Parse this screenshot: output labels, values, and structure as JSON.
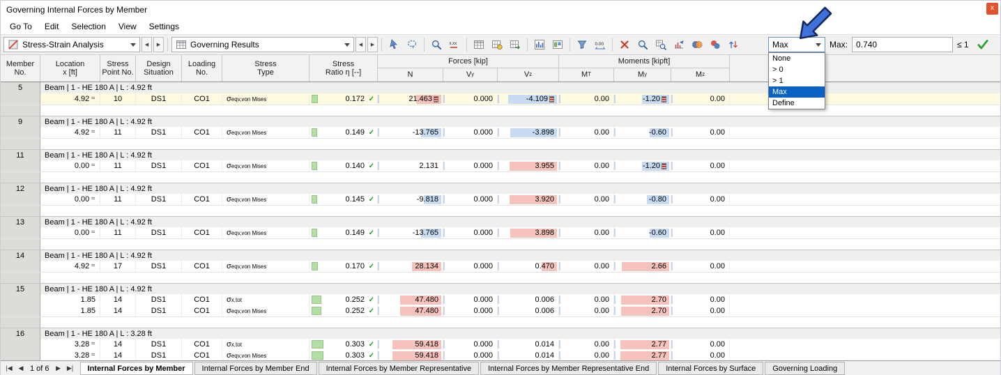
{
  "window": {
    "title": "Governing Internal Forces by Member",
    "close_label": "x"
  },
  "menu": {
    "items": [
      "Go To",
      "Edit",
      "Selection",
      "View",
      "Settings"
    ]
  },
  "toolbar": {
    "analysis_label": "Stress-Strain Analysis",
    "results_label": "Governing Results",
    "nav": {
      "prev": "◀",
      "next": "▶"
    },
    "icon_groups": [
      [
        {
          "name": "pointer-select-icon",
          "type": "pointer"
        },
        {
          "name": "lasso-select-icon",
          "type": "lasso"
        }
      ],
      [
        {
          "name": "show-result-values-icon",
          "type": "maglens"
        },
        {
          "name": "numeric-values-icon",
          "type": "xxx"
        }
      ],
      [
        {
          "name": "table-view-icon",
          "type": "table"
        },
        {
          "name": "table-manager-icon",
          "type": "table2"
        },
        {
          "name": "table-export-icon",
          "type": "table3"
        }
      ],
      [
        {
          "name": "result-diagram-icon",
          "type": "chart"
        },
        {
          "name": "result-panel-icon",
          "type": "panel"
        }
      ],
      [
        {
          "name": "filter-icon",
          "type": "funnel"
        },
        {
          "name": "decimal-places-icon",
          "type": "zeros"
        }
      ],
      [
        {
          "name": "delete-results-icon",
          "type": "delete"
        },
        {
          "name": "search-icon",
          "type": "maglens"
        },
        {
          "name": "find-in-table-icon",
          "type": "magtable"
        },
        {
          "name": "result-relations-icon",
          "type": "chartarrow"
        },
        {
          "name": "color-scale-icon",
          "type": "circles"
        },
        {
          "name": "member-colors-icon",
          "type": "circles2"
        },
        {
          "name": "sort-icon",
          "type": "sort"
        }
      ]
    ],
    "extreme": {
      "value": "Max",
      "options": [
        "None",
        "> 0",
        "> 1",
        "Max",
        "Define"
      ],
      "selected": "Max"
    },
    "max_label": "Max:",
    "max_value": "0.740",
    "limit_label": "≤ 1"
  },
  "table": {
    "marker_glyph": "≍",
    "ok_glyph": "✓",
    "columns": [
      {
        "id": "member-no",
        "line1": "Member",
        "line2": "No."
      },
      {
        "id": "location",
        "line1": "Location",
        "line2": "x [ft]"
      },
      {
        "id": "stress-point",
        "line1": "Stress",
        "line2": "Point No."
      },
      {
        "id": "design-situation",
        "line1": "Design",
        "line2": "Situation"
      },
      {
        "id": "loading",
        "line1": "Loading",
        "line2": "No."
      },
      {
        "id": "stress-type",
        "line1": "Stress",
        "line2": "Type"
      },
      {
        "id": "stress-ratio",
        "line1": "Stress",
        "line2": "Ratio η [--]"
      }
    ],
    "forces_group": {
      "label": "Forces [kip]",
      "subs": [
        [
          "N",
          ""
        ],
        [
          "V",
          "y"
        ],
        [
          "V",
          "z"
        ]
      ]
    },
    "moments_group": {
      "label": "Moments [kipft]",
      "subs": [
        [
          "M",
          "T"
        ],
        [
          "M",
          "y"
        ],
        [
          "M",
          "z"
        ]
      ]
    },
    "groups": [
      {
        "member_no": "5",
        "header": "Beam | 1 - HE 180 A | L : 4.92 ft",
        "rows": [
          {
            "location": "4.92",
            "marker": true,
            "stress_point": "10",
            "design_situation": "DS1",
            "loading": "CO1",
            "stress_type": {
              "main": "σ",
              "sub": "eqv,von Mises"
            },
            "ratio": "0.172",
            "n": {
              "v": "21.463",
              "hl": "pos",
              "flag": true
            },
            "vy": "0.000",
            "vz": {
              "v": "-4.109",
              "hl": "neg",
              "flag": true
            },
            "mt": "0.00",
            "my": {
              "v": "-1.20",
              "hl": "neg",
              "flag": true
            },
            "mz": "0.00",
            "governing": true
          }
        ]
      },
      {
        "member_no": "9",
        "header": "Beam | 1 - HE 180 A | L : 4.92 ft",
        "rows": [
          {
            "location": "4.92",
            "marker": true,
            "stress_point": "11",
            "design_situation": "DS1",
            "loading": "CO1",
            "stress_type": {
              "main": "σ",
              "sub": "eqv,von Mises"
            },
            "ratio": "0.149",
            "n": {
              "v": "-13.765",
              "hl": "neg"
            },
            "vy": "0.000",
            "vz": {
              "v": "-3.898",
              "hl": "neg"
            },
            "mt": "0.00",
            "my": {
              "v": "-0.60",
              "hl": "neg"
            },
            "mz": "0.00"
          }
        ]
      },
      {
        "member_no": "11",
        "header": "Beam | 1 - HE 180 A | L : 4.92 ft",
        "rows": [
          {
            "location": "0.00",
            "marker": true,
            "stress_point": "11",
            "design_situation": "DS1",
            "loading": "CO1",
            "stress_type": {
              "main": "σ",
              "sub": "eqv,von Mises"
            },
            "ratio": "0.140",
            "n": "2.131",
            "vy": "0.000",
            "vz": {
              "v": "3.955",
              "hl": "pos"
            },
            "mt": "0.00",
            "my": {
              "v": "-1.20",
              "hl": "neg",
              "flag": true
            },
            "mz": "0.00"
          }
        ]
      },
      {
        "member_no": "12",
        "header": "Beam | 1 - HE 180 A | L : 4.92 ft",
        "rows": [
          {
            "location": "0.00",
            "marker": true,
            "stress_point": "11",
            "design_situation": "DS1",
            "loading": "CO1",
            "stress_type": {
              "main": "σ",
              "sub": "eqv,von Mises"
            },
            "ratio": "0.145",
            "n": {
              "v": "-9.818",
              "hl": "neg"
            },
            "vy": "0.000",
            "vz": {
              "v": "3.920",
              "hl": "pos"
            },
            "mt": "0.00",
            "my": {
              "v": "-0.80",
              "hl": "neg"
            },
            "mz": "0.00"
          }
        ]
      },
      {
        "member_no": "13",
        "header": "Beam | 1 - HE 180 A | L : 4.92 ft",
        "rows": [
          {
            "location": "0.00",
            "marker": true,
            "stress_point": "11",
            "design_situation": "DS1",
            "loading": "CO1",
            "stress_type": {
              "main": "σ",
              "sub": "eqv,von Mises"
            },
            "ratio": "0.149",
            "n": {
              "v": "-13.765",
              "hl": "neg"
            },
            "vy": "0.000",
            "vz": {
              "v": "3.898",
              "hl": "pos"
            },
            "mt": "0.00",
            "my": {
              "v": "-0.60",
              "hl": "neg"
            },
            "mz": "0.00"
          }
        ]
      },
      {
        "member_no": "14",
        "header": "Beam | 1 - HE 180 A | L : 4.92 ft",
        "rows": [
          {
            "location": "4.92",
            "marker": true,
            "stress_point": "17",
            "design_situation": "DS1",
            "loading": "CO1",
            "stress_type": {
              "main": "σ",
              "sub": "eqv,von Mises"
            },
            "ratio": "0.170",
            "n": {
              "v": "28.134",
              "hl": "pos"
            },
            "vy": "0.000",
            "vz": {
              "v": "0.470",
              "hl": "pos"
            },
            "mt": "0.00",
            "my": {
              "v": "2.66",
              "hl": "pos"
            },
            "mz": "0.00"
          }
        ]
      },
      {
        "member_no": "15",
        "header": "Beam | 1 - HE 180 A | L : 4.92 ft",
        "rows": [
          {
            "location": "1.85",
            "marker": false,
            "stress_point": "14",
            "design_situation": "DS1",
            "loading": "CO1",
            "stress_type": {
              "main": "σ",
              "sub": "x,tot"
            },
            "ratio": "0.252",
            "n": {
              "v": "47.480",
              "hl": "pos"
            },
            "vy": "0.000",
            "vz": "0.006",
            "mt": "0.00",
            "my": {
              "v": "2.70",
              "hl": "pos"
            },
            "mz": "0.00"
          },
          {
            "location": "1.85",
            "marker": false,
            "stress_point": "14",
            "design_situation": "DS1",
            "loading": "CO1",
            "stress_type": {
              "main": "σ",
              "sub": "eqv,von Mises"
            },
            "ratio": "0.252",
            "n": {
              "v": "47.480",
              "hl": "pos"
            },
            "vy": "0.000",
            "vz": "0.006",
            "mt": "0.00",
            "my": {
              "v": "2.70",
              "hl": "pos"
            },
            "mz": "0.00"
          }
        ]
      },
      {
        "member_no": "16",
        "header": "Beam | 1 - HE 180 A | L : 3.28 ft",
        "rows": [
          {
            "location": "3.28",
            "marker": true,
            "stress_point": "14",
            "design_situation": "DS1",
            "loading": "CO1",
            "stress_type": {
              "main": "σ",
              "sub": "x,tot"
            },
            "ratio": "0.303",
            "n": {
              "v": "59.418",
              "hl": "pos"
            },
            "vy": "0.000",
            "vz": "0.014",
            "mt": "0.00",
            "my": {
              "v": "2.77",
              "hl": "pos"
            },
            "mz": "0.00"
          },
          {
            "location": "3.28",
            "marker": true,
            "stress_point": "14",
            "design_situation": "DS1",
            "loading": "CO1",
            "stress_type": {
              "main": "σ",
              "sub": "eqv,von Mises"
            },
            "ratio": "0.303",
            "n": {
              "v": "59.418",
              "hl": "pos"
            },
            "vy": "0.000",
            "vz": "0.014",
            "mt": "0.00",
            "my": {
              "v": "2.77",
              "hl": "pos"
            },
            "mz": "0.00"
          }
        ]
      }
    ]
  },
  "footer": {
    "page_label": "1 of 6",
    "nav": {
      "first": "|◀",
      "prev": "◀",
      "next": "▶",
      "last": "▶|"
    },
    "tabs": [
      {
        "label": "Internal Forces by Member",
        "active": true
      },
      {
        "label": "Internal Forces by Member End",
        "active": false
      },
      {
        "label": "Internal Forces by Member Representative",
        "active": false
      },
      {
        "label": "Internal Forces by Member Representative End",
        "active": false
      },
      {
        "label": "Internal Forces by Surface",
        "active": false
      },
      {
        "label": "Governing Loading",
        "active": false
      }
    ]
  },
  "colors": {
    "selection_blue": "#0a63c4",
    "positive_bar": "#f6c2bc",
    "negative_bar": "#c9dbf2",
    "ratio_bar": "#b4dfa4",
    "governing_row": "#fffbe2",
    "check_green": "#209420",
    "close_button": "#e0532e",
    "cursor_blue": "#3f72d9"
  }
}
